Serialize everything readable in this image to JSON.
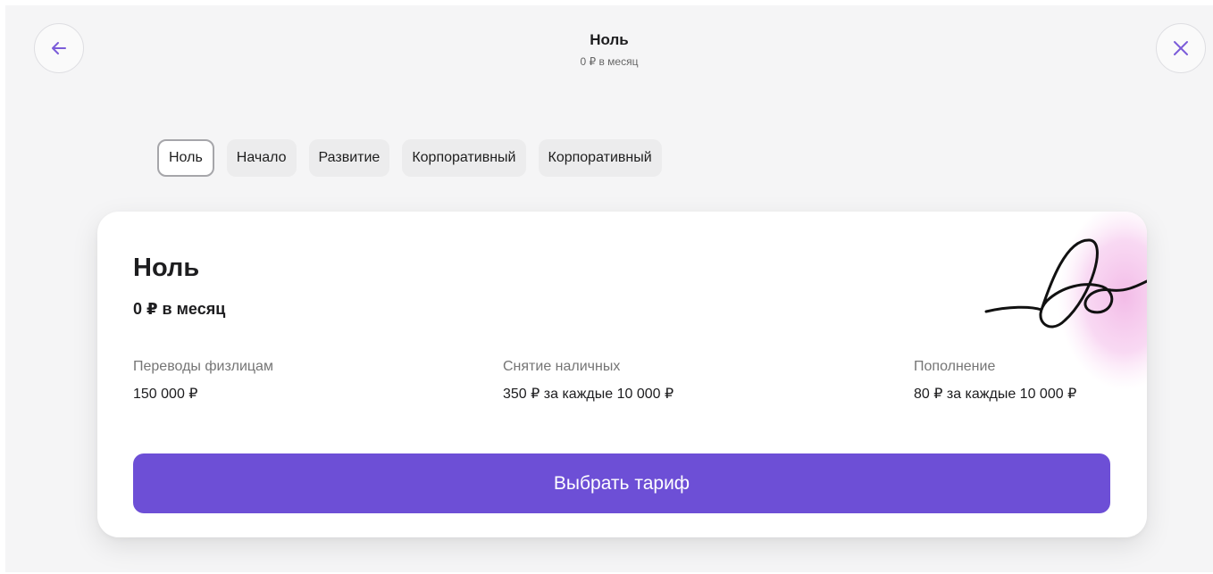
{
  "header": {
    "title": "Ноль",
    "subtitle": "0 ₽ в месяц",
    "back_icon": "arrow-left-icon",
    "close_icon": "close-icon"
  },
  "tabs": [
    {
      "label": "Ноль",
      "active": true
    },
    {
      "label": "Начало",
      "active": false
    },
    {
      "label": "Развитие",
      "active": false
    },
    {
      "label": "Корпоративный",
      "active": false
    },
    {
      "label": "Корпоративный",
      "active": false
    }
  ],
  "card": {
    "title": "Ноль",
    "price": "0 ₽ в месяц",
    "features": [
      {
        "label": "Переводы физлицам",
        "value": "150 000 ₽"
      },
      {
        "label": "Снятие наличных",
        "value": "350 ₽ за каждые 10 000 ₽"
      },
      {
        "label": "Пополнение",
        "value": "80 ₽ за каждые 10 000 ₽"
      }
    ],
    "decoration": "signature-scribble-illustration",
    "button_label": "Выбрать тариф"
  },
  "colors": {
    "accent": "#6d4fd6",
    "icon_accent": "#7b5cd9",
    "background": "#f5f5f6",
    "card": "#ffffff",
    "tab_bg": "#ececed",
    "tab_active_border": "#a6a6aa",
    "muted_text": "#757575",
    "decor_pink": "#f2b8e6"
  }
}
